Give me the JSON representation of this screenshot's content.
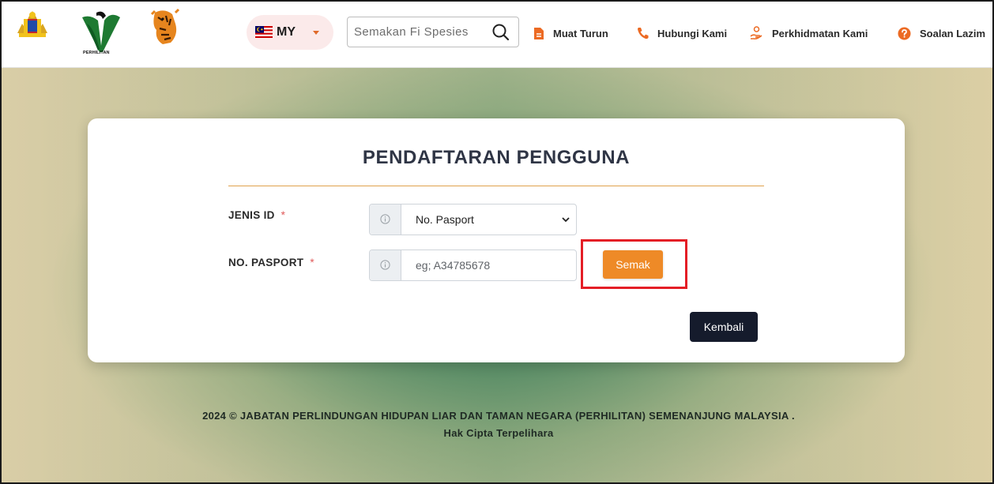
{
  "header": {
    "logo_text": "PERHILITAN",
    "language": {
      "label": "MY"
    },
    "search": {
      "placeholder": "Semakan Fi Spesies"
    },
    "nav": [
      {
        "label": "Muat Turun",
        "icon": "document-icon"
      },
      {
        "label": "Hubungi Kami",
        "icon": "phone-icon"
      },
      {
        "label": "Perkhidmatan Kami",
        "icon": "service-hand-icon"
      },
      {
        "label": "Soalan Lazim",
        "icon": "help-icon"
      }
    ]
  },
  "form": {
    "title": "PENDAFTARAN PENGGUNA",
    "id_type": {
      "label": "JENIS ID",
      "required": "*",
      "selected": "No. Pasport"
    },
    "passport": {
      "label": "NO. PASPORT",
      "required": "*",
      "placeholder": "eg; A34785678",
      "value": ""
    },
    "check_button": "Semak",
    "back_button": "Kembali"
  },
  "footer": {
    "line1": "2024 © JABATAN PERLINDUNGAN HIDUPAN LIAR DAN TAMAN NEGARA (PERHILITAN) SEMENANJUNG MALAYSIA .",
    "line2": "Hak Cipta Terpelihara"
  },
  "colors": {
    "accent_orange": "#ee8a27",
    "highlight_red": "#e41e26",
    "dark_button": "#151b2c"
  }
}
